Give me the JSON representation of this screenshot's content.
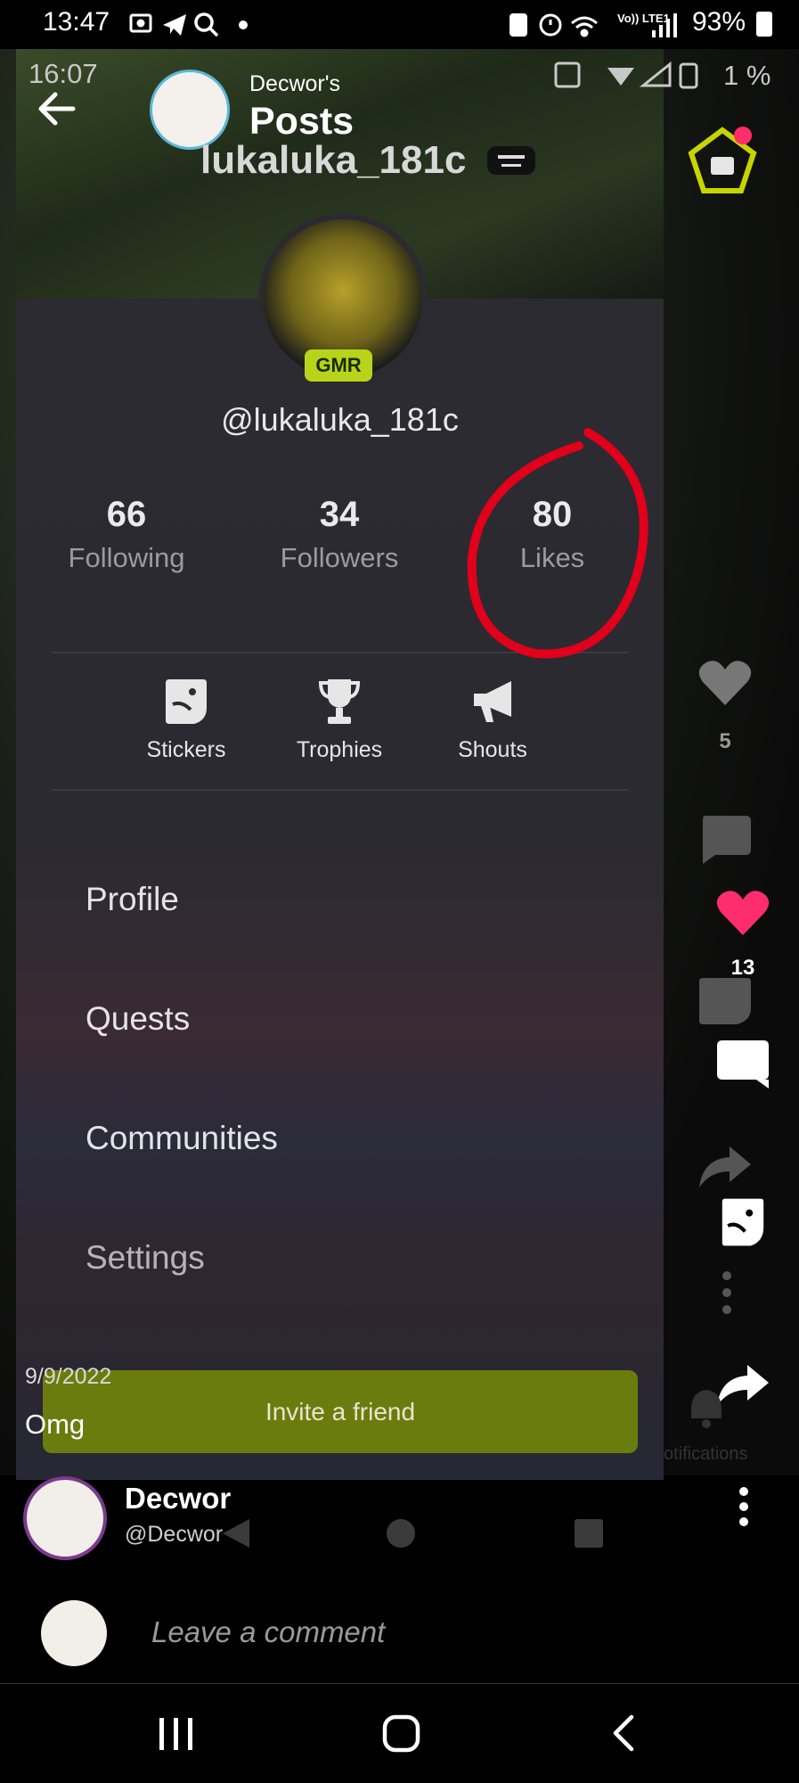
{
  "status_bar": {
    "time": "13:47",
    "left_icons": [
      "cast-icon",
      "telegram-icon",
      "search-icon",
      "dot-icon"
    ],
    "right_text": "93%",
    "right_icons": [
      "recycle-icon",
      "alarm-icon",
      "wifi-icon",
      "volte-icon",
      "signal-icon",
      "battery-icon"
    ],
    "volte_label": "Vo)) LTE1"
  },
  "inner_status_bar": {
    "time": "16:07",
    "battery": "1 %"
  },
  "post_header": {
    "poster_name": "Decwor's",
    "title": "Posts"
  },
  "drawer": {
    "username": "lukaluka_181c",
    "handle": "@lukaluka_181c",
    "badge": "GMR",
    "stats": [
      {
        "value": "66",
        "label": "Following"
      },
      {
        "value": "34",
        "label": "Followers"
      },
      {
        "value": "80",
        "label": "Likes"
      }
    ],
    "tiles": [
      {
        "label": "Stickers",
        "icon": "sticker-icon"
      },
      {
        "label": "Trophies",
        "icon": "trophy-icon"
      },
      {
        "label": "Shouts",
        "icon": "megaphone-icon"
      }
    ],
    "menu": [
      "Profile",
      "Quests",
      "Communities",
      "Settings"
    ],
    "invite_label": "Invite a friend",
    "notifications_label": "otifications"
  },
  "right_rail": {
    "faded_like_count": "5",
    "like_count": "13"
  },
  "post": {
    "date": "9/9/2022",
    "caption": "Omg",
    "author_name": "Decwor",
    "author_handle": "@Decwor"
  },
  "comment": {
    "placeholder": "Leave a comment"
  },
  "colors": {
    "accent_like": "#ff2d6b",
    "invite_bg": "#6b7c0e",
    "gmr_badge": "#b8d41a",
    "annotation": "#e0001b"
  }
}
